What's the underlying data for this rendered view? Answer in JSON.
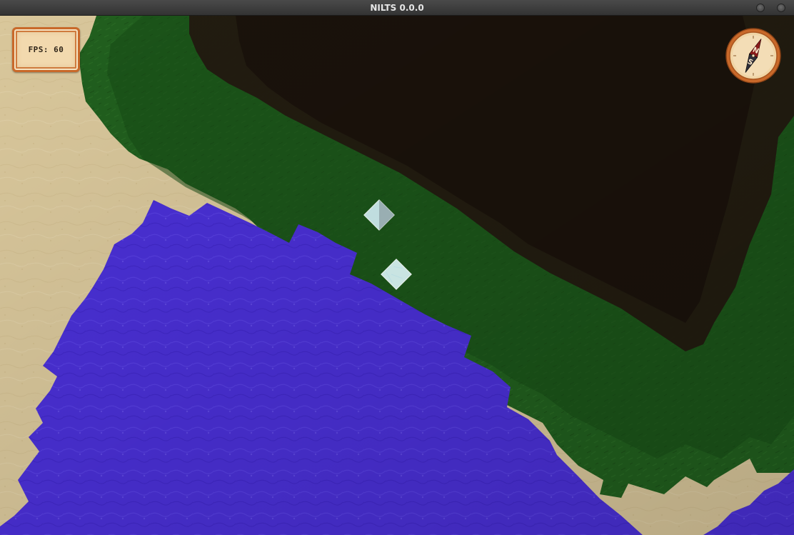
{
  "window": {
    "title": "NILTS 0.0.0"
  },
  "hud": {
    "fps_text": "FPS: 60",
    "compass": {
      "north_label": "N",
      "south_label": "S"
    }
  },
  "colors": {
    "sand": "#d9c79b",
    "sand_dark": "#c4b07e",
    "grass": "#1f5e1d",
    "grass_dark": "#123d12",
    "shadow": "#1b140d",
    "water": "#4a2fd8",
    "water_light": "#5b43e2",
    "frame_orange": "#c9692a",
    "panel_bg": "#f2d9ae"
  },
  "icons": [
    "compass-icon",
    "minimize-icon",
    "close-icon",
    "ice-block-icon"
  ]
}
